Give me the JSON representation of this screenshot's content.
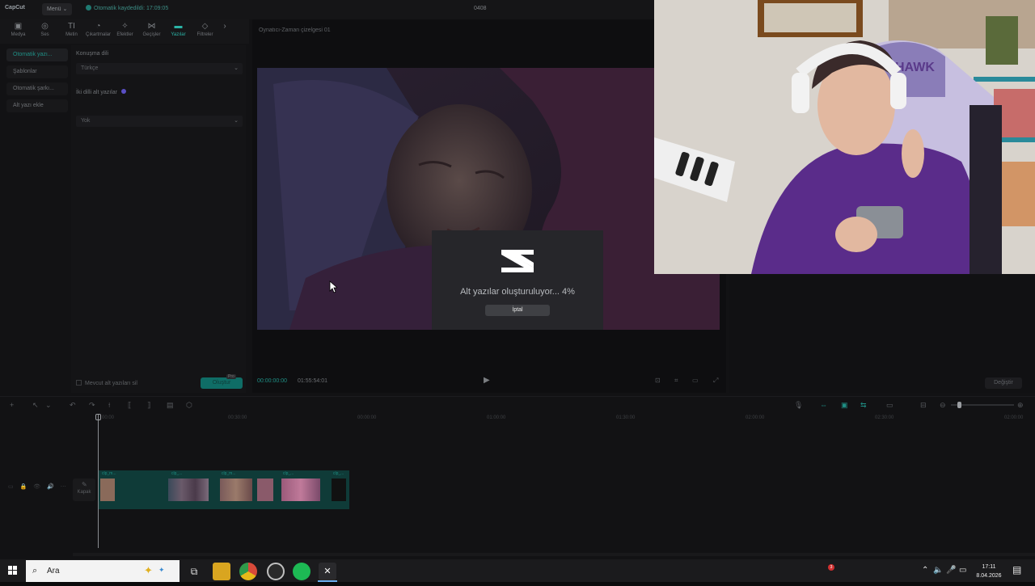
{
  "app": {
    "logo": "CapCut",
    "menu_label": "Menü",
    "menu_chevron": "⌄",
    "autosave": "Otomatik kaydedildi: 17:09:05",
    "project_title": "0408"
  },
  "toolbar": {
    "items": [
      {
        "label": "Medya",
        "icon": "media-icon",
        "glyph": "▣"
      },
      {
        "label": "Ses",
        "icon": "audio-icon",
        "glyph": "◎"
      },
      {
        "label": "Metin",
        "icon": "text-icon",
        "glyph": "TI"
      },
      {
        "label": "Çıkartmalar",
        "icon": "sticker-icon",
        "glyph": "◔"
      },
      {
        "label": "Efektler",
        "icon": "effects-icon",
        "glyph": "✧"
      },
      {
        "label": "Geçişler",
        "icon": "transitions-icon",
        "glyph": "⋈"
      },
      {
        "label": "Yazılar",
        "icon": "captions-icon",
        "glyph": "▬"
      },
      {
        "label": "Filtreler",
        "icon": "filters-icon",
        "glyph": "◇"
      }
    ],
    "collapse_glyph": "›"
  },
  "subnav": {
    "items": [
      {
        "label": "Otomatik yazı...",
        "active": true
      },
      {
        "label": "Şablonlar",
        "active": false
      },
      {
        "label": "Otomatik şarkı...",
        "active": false
      },
      {
        "label": "Alt yazı ekle",
        "active": false
      }
    ]
  },
  "panel": {
    "speech_language_label": "Konuşma dili",
    "speech_language_value": "Türkçe",
    "bilingual_label": "İki dilli alt yazılar",
    "bilingual_value": "Yok",
    "chevron": "⌄",
    "remove_existing_label": "Mevcut alt yazıları sil",
    "create_button": "Oluştur",
    "pro_badge": "Pro"
  },
  "player": {
    "title": "Oynatıcı-Zaman çizelgesi 01",
    "timecode_current": "00:00:00:00",
    "timecode_total": "01:55:54:01",
    "play_glyph": "▶",
    "ctrl_glyphs": [
      "⊡",
      "⌗",
      "▭",
      "⤢"
    ]
  },
  "right_panel": {
    "change_button": "Değiştir"
  },
  "timeline": {
    "toolbar_left": [
      "+",
      "↖",
      "⌄",
      "↶",
      "↷",
      "⟊",
      "⟦",
      "⟧",
      "▤",
      "⬡"
    ],
    "toolbar_right": [
      "🎙",
      "⇔",
      "▣",
      "⇆",
      "▭",
      "⊟",
      "⊖"
    ],
    "ruler_ticks": [
      "00:00",
      "00:30:00",
      "00:00:00",
      "01:00:00",
      "01:30:00",
      "02:00:00",
      "02:30:00",
      "02:00:00"
    ],
    "track_icons": [
      "▭",
      "🔒",
      "👁",
      "🔊",
      "⋯"
    ],
    "cover_label": "Kapak",
    "cover_glyph": "✎",
    "clip_labels": [
      "clp_m...",
      "clp_...",
      "clp_...",
      "clp_m...",
      "clp_..."
    ]
  },
  "modal": {
    "message": "Alt yazılar oluşturuluyor... 4%",
    "progress_percent": 4,
    "cancel_label": "İptal"
  },
  "taskbar": {
    "search_placeholder": "Ara",
    "search_glyph": "⌕",
    "tray_glyphs": [
      "⌃",
      "🔈",
      "🎤",
      "▭",
      "🔋"
    ],
    "time": "17:11",
    "date": "8.04.2026",
    "notification_count": "3"
  },
  "colors": {
    "accent": "#2bb3a6",
    "panel_bg": "#141416",
    "modal_bg": "#26262a",
    "taskbar_bg": "#1b1b1d"
  }
}
